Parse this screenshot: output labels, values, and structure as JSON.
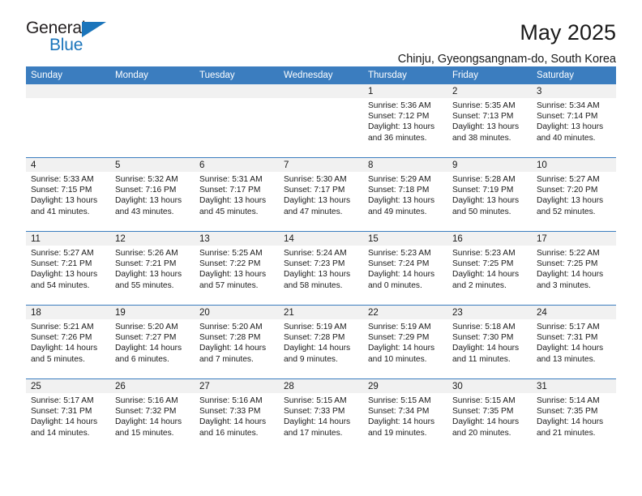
{
  "brand": {
    "name_top": "General",
    "name_bottom": "Blue",
    "triangle_icon": "blue-triangle-icon",
    "color_dark": "#231f20",
    "color_blue": "#1b75bb"
  },
  "header": {
    "title": "May 2025",
    "subtitle": "Chinju, Gyeongsangnam-do, South Korea"
  },
  "colors": {
    "header_row": "#3b7dbf",
    "daynum_band": "#f1f1f1",
    "text": "#1a1a1a"
  },
  "weekday_headers": [
    "Sunday",
    "Monday",
    "Tuesday",
    "Wednesday",
    "Thursday",
    "Friday",
    "Saturday"
  ],
  "weeks": [
    [
      {
        "day": "",
        "sunrise": "",
        "sunset": "",
        "daylight_line1": "",
        "daylight_line2": ""
      },
      {
        "day": "",
        "sunrise": "",
        "sunset": "",
        "daylight_line1": "",
        "daylight_line2": ""
      },
      {
        "day": "",
        "sunrise": "",
        "sunset": "",
        "daylight_line1": "",
        "daylight_line2": ""
      },
      {
        "day": "",
        "sunrise": "",
        "sunset": "",
        "daylight_line1": "",
        "daylight_line2": ""
      },
      {
        "day": "1",
        "sunrise": "Sunrise: 5:36 AM",
        "sunset": "Sunset: 7:12 PM",
        "daylight_line1": "Daylight: 13 hours",
        "daylight_line2": "and 36 minutes."
      },
      {
        "day": "2",
        "sunrise": "Sunrise: 5:35 AM",
        "sunset": "Sunset: 7:13 PM",
        "daylight_line1": "Daylight: 13 hours",
        "daylight_line2": "and 38 minutes."
      },
      {
        "day": "3",
        "sunrise": "Sunrise: 5:34 AM",
        "sunset": "Sunset: 7:14 PM",
        "daylight_line1": "Daylight: 13 hours",
        "daylight_line2": "and 40 minutes."
      }
    ],
    [
      {
        "day": "4",
        "sunrise": "Sunrise: 5:33 AM",
        "sunset": "Sunset: 7:15 PM",
        "daylight_line1": "Daylight: 13 hours",
        "daylight_line2": "and 41 minutes."
      },
      {
        "day": "5",
        "sunrise": "Sunrise: 5:32 AM",
        "sunset": "Sunset: 7:16 PM",
        "daylight_line1": "Daylight: 13 hours",
        "daylight_line2": "and 43 minutes."
      },
      {
        "day": "6",
        "sunrise": "Sunrise: 5:31 AM",
        "sunset": "Sunset: 7:17 PM",
        "daylight_line1": "Daylight: 13 hours",
        "daylight_line2": "and 45 minutes."
      },
      {
        "day": "7",
        "sunrise": "Sunrise: 5:30 AM",
        "sunset": "Sunset: 7:17 PM",
        "daylight_line1": "Daylight: 13 hours",
        "daylight_line2": "and 47 minutes."
      },
      {
        "day": "8",
        "sunrise": "Sunrise: 5:29 AM",
        "sunset": "Sunset: 7:18 PM",
        "daylight_line1": "Daylight: 13 hours",
        "daylight_line2": "and 49 minutes."
      },
      {
        "day": "9",
        "sunrise": "Sunrise: 5:28 AM",
        "sunset": "Sunset: 7:19 PM",
        "daylight_line1": "Daylight: 13 hours",
        "daylight_line2": "and 50 minutes."
      },
      {
        "day": "10",
        "sunrise": "Sunrise: 5:27 AM",
        "sunset": "Sunset: 7:20 PM",
        "daylight_line1": "Daylight: 13 hours",
        "daylight_line2": "and 52 minutes."
      }
    ],
    [
      {
        "day": "11",
        "sunrise": "Sunrise: 5:27 AM",
        "sunset": "Sunset: 7:21 PM",
        "daylight_line1": "Daylight: 13 hours",
        "daylight_line2": "and 54 minutes."
      },
      {
        "day": "12",
        "sunrise": "Sunrise: 5:26 AM",
        "sunset": "Sunset: 7:21 PM",
        "daylight_line1": "Daylight: 13 hours",
        "daylight_line2": "and 55 minutes."
      },
      {
        "day": "13",
        "sunrise": "Sunrise: 5:25 AM",
        "sunset": "Sunset: 7:22 PM",
        "daylight_line1": "Daylight: 13 hours",
        "daylight_line2": "and 57 minutes."
      },
      {
        "day": "14",
        "sunrise": "Sunrise: 5:24 AM",
        "sunset": "Sunset: 7:23 PM",
        "daylight_line1": "Daylight: 13 hours",
        "daylight_line2": "and 58 minutes."
      },
      {
        "day": "15",
        "sunrise": "Sunrise: 5:23 AM",
        "sunset": "Sunset: 7:24 PM",
        "daylight_line1": "Daylight: 14 hours",
        "daylight_line2": "and 0 minutes."
      },
      {
        "day": "16",
        "sunrise": "Sunrise: 5:23 AM",
        "sunset": "Sunset: 7:25 PM",
        "daylight_line1": "Daylight: 14 hours",
        "daylight_line2": "and 2 minutes."
      },
      {
        "day": "17",
        "sunrise": "Sunrise: 5:22 AM",
        "sunset": "Sunset: 7:25 PM",
        "daylight_line1": "Daylight: 14 hours",
        "daylight_line2": "and 3 minutes."
      }
    ],
    [
      {
        "day": "18",
        "sunrise": "Sunrise: 5:21 AM",
        "sunset": "Sunset: 7:26 PM",
        "daylight_line1": "Daylight: 14 hours",
        "daylight_line2": "and 5 minutes."
      },
      {
        "day": "19",
        "sunrise": "Sunrise: 5:20 AM",
        "sunset": "Sunset: 7:27 PM",
        "daylight_line1": "Daylight: 14 hours",
        "daylight_line2": "and 6 minutes."
      },
      {
        "day": "20",
        "sunrise": "Sunrise: 5:20 AM",
        "sunset": "Sunset: 7:28 PM",
        "daylight_line1": "Daylight: 14 hours",
        "daylight_line2": "and 7 minutes."
      },
      {
        "day": "21",
        "sunrise": "Sunrise: 5:19 AM",
        "sunset": "Sunset: 7:28 PM",
        "daylight_line1": "Daylight: 14 hours",
        "daylight_line2": "and 9 minutes."
      },
      {
        "day": "22",
        "sunrise": "Sunrise: 5:19 AM",
        "sunset": "Sunset: 7:29 PM",
        "daylight_line1": "Daylight: 14 hours",
        "daylight_line2": "and 10 minutes."
      },
      {
        "day": "23",
        "sunrise": "Sunrise: 5:18 AM",
        "sunset": "Sunset: 7:30 PM",
        "daylight_line1": "Daylight: 14 hours",
        "daylight_line2": "and 11 minutes."
      },
      {
        "day": "24",
        "sunrise": "Sunrise: 5:17 AM",
        "sunset": "Sunset: 7:31 PM",
        "daylight_line1": "Daylight: 14 hours",
        "daylight_line2": "and 13 minutes."
      }
    ],
    [
      {
        "day": "25",
        "sunrise": "Sunrise: 5:17 AM",
        "sunset": "Sunset: 7:31 PM",
        "daylight_line1": "Daylight: 14 hours",
        "daylight_line2": "and 14 minutes."
      },
      {
        "day": "26",
        "sunrise": "Sunrise: 5:16 AM",
        "sunset": "Sunset: 7:32 PM",
        "daylight_line1": "Daylight: 14 hours",
        "daylight_line2": "and 15 minutes."
      },
      {
        "day": "27",
        "sunrise": "Sunrise: 5:16 AM",
        "sunset": "Sunset: 7:33 PM",
        "daylight_line1": "Daylight: 14 hours",
        "daylight_line2": "and 16 minutes."
      },
      {
        "day": "28",
        "sunrise": "Sunrise: 5:15 AM",
        "sunset": "Sunset: 7:33 PM",
        "daylight_line1": "Daylight: 14 hours",
        "daylight_line2": "and 17 minutes."
      },
      {
        "day": "29",
        "sunrise": "Sunrise: 5:15 AM",
        "sunset": "Sunset: 7:34 PM",
        "daylight_line1": "Daylight: 14 hours",
        "daylight_line2": "and 19 minutes."
      },
      {
        "day": "30",
        "sunrise": "Sunrise: 5:15 AM",
        "sunset": "Sunset: 7:35 PM",
        "daylight_line1": "Daylight: 14 hours",
        "daylight_line2": "and 20 minutes."
      },
      {
        "day": "31",
        "sunrise": "Sunrise: 5:14 AM",
        "sunset": "Sunset: 7:35 PM",
        "daylight_line1": "Daylight: 14 hours",
        "daylight_line2": "and 21 minutes."
      }
    ]
  ]
}
